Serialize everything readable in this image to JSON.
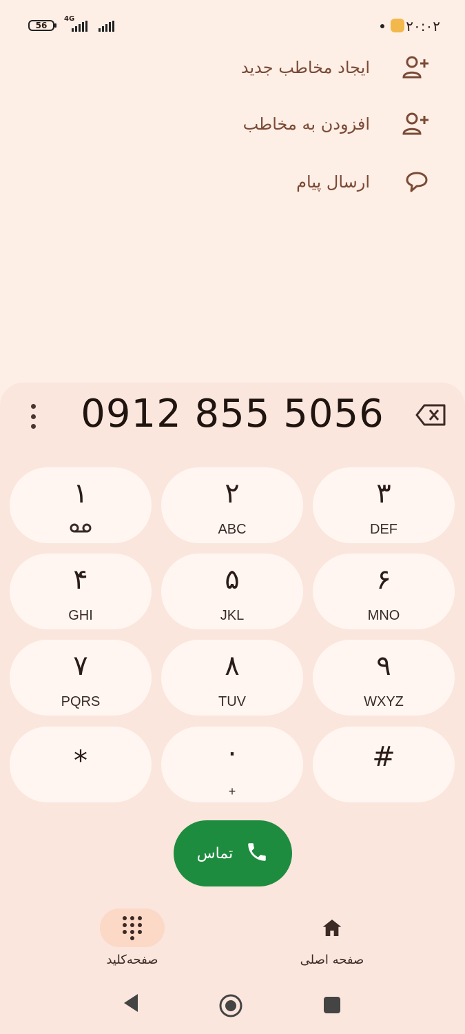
{
  "status_bar": {
    "battery": "56",
    "network": "4G",
    "time": "۲۰:۰۲"
  },
  "actions": [
    {
      "label": "ایجاد مخاطب جدید",
      "icon": "add-person-icon"
    },
    {
      "label": "افزودن به مخاطب",
      "icon": "add-person-icon"
    },
    {
      "label": "ارسال پیام",
      "icon": "message-bubble-icon"
    }
  ],
  "dialer": {
    "number": "0912 855 5056",
    "keys": [
      {
        "digit": "۱",
        "letters": ""
      },
      {
        "digit": "۲",
        "letters": "ABC"
      },
      {
        "digit": "۳",
        "letters": "DEF"
      },
      {
        "digit": "۴",
        "letters": "GHI"
      },
      {
        "digit": "۵",
        "letters": "JKL"
      },
      {
        "digit": "۶",
        "letters": "MNO"
      },
      {
        "digit": "۷",
        "letters": "PQRS"
      },
      {
        "digit": "۸",
        "letters": "TUV"
      },
      {
        "digit": "۹",
        "letters": "WXYZ"
      },
      {
        "digit": "*",
        "letters": ""
      },
      {
        "digit": "۰",
        "letters": "+"
      },
      {
        "digit": "#",
        "letters": ""
      }
    ],
    "call_label": "تماس"
  },
  "bottom_nav": {
    "keypad_label": "صفحه‌کلید",
    "home_label": "صفحه اصلی"
  },
  "colors": {
    "background": "#fdeee6",
    "panel": "#fae6dc",
    "key": "#fff6f2",
    "call": "#1e8c3f",
    "accent_text": "#7a4a35"
  }
}
